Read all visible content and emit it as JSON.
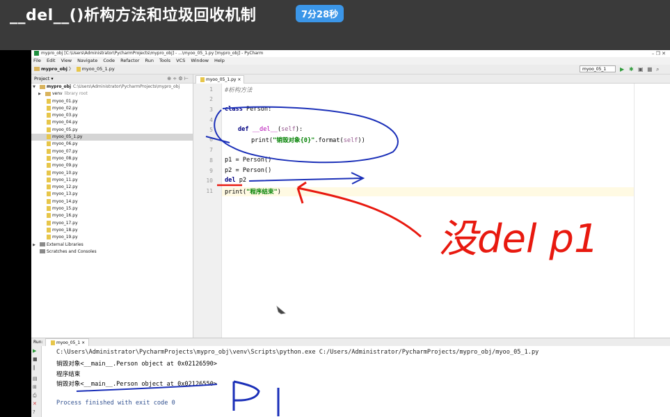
{
  "lesson": {
    "title": "__del__()析构方法和垃圾回收机制",
    "timer": "7分28秒"
  },
  "window": {
    "title": "mypro_obj [C:\\Users\\Administrator\\PycharmProjects\\mypro_obj] - ...\\myoo_05_1.py [mypro_obj] - PyCharm",
    "controls": "–  ❐  ✕"
  },
  "menu": [
    "File",
    "Edit",
    "View",
    "Navigate",
    "Code",
    "Refactor",
    "Run",
    "Tools",
    "VCS",
    "Window",
    "Help"
  ],
  "nav": {
    "project": "mypro_obj",
    "file": "myoo_05_1.py",
    "run_config": "myoo_05_1"
  },
  "project_panel": {
    "header": "Project",
    "root_name": "mypro_obj",
    "root_path": "C:\\Users\\Administrator\\PycharmProjects\\mypro_obj",
    "venv": "venv",
    "venv_note": "library root",
    "files": [
      "myoo_01.py",
      "myoo_02.py",
      "myoo_03.py",
      "myoo_04.py",
      "myoo_05.py",
      "myoo_05_1.py",
      "myoo_06.py",
      "myoo_07.py",
      "myoo_08.py",
      "myoo_09.py",
      "myoo_10.py",
      "myoo_11.py",
      "myoo_12.py",
      "myoo_13.py",
      "myoo_14.py",
      "myoo_15.py",
      "myoo_16.py",
      "myoo_17.py",
      "myoo_18.py",
      "myoo_19.py"
    ],
    "selected_file": "myoo_05_1.py",
    "external": "External Libraries",
    "scratches": "Scratches and Consoles"
  },
  "editor": {
    "tab": "myoo_05_1.py",
    "line_numbers": [
      "1",
      "2",
      "3",
      "4",
      "5",
      "6",
      "7",
      "8",
      "9",
      "10",
      "11"
    ],
    "lines": {
      "l1": "#析构方法",
      "l3_kw": "class",
      "l3_rest": " Person:",
      "l5_kw": "def",
      "l5_name": " __del__",
      "l5_open": "(",
      "l5_self": "self",
      "l5_close": "):",
      "l6_pre": "print(",
      "l6_str": "\"销毁对象{0}\"",
      "l6_mid": ".format(",
      "l6_self": "self",
      "l6_end": "))",
      "l8": "p1 = Person()",
      "l9": "p2 = Person()",
      "l10_kw": "del",
      "l10_rest": " p2",
      "l11_pre": "print(",
      "l11_str": "\"程序结束\"",
      "l11_end": ")"
    }
  },
  "run": {
    "label": "Run:",
    "tab": "myoo_05_1",
    "output": [
      "C:\\Users\\Administrator\\PycharmProjects\\mypro_obj\\venv\\Scripts\\python.exe C:/Users/Administrator/PycharmProjects/mypro_obj/myoo_05_1.py",
      "销毁对象<__main__.Person object at 0x02126590>",
      "程序结束",
      "销毁对象<__main__.Person object at 0x02126550>",
      "",
      "Process finished with exit code 0"
    ]
  },
  "annotations": {
    "handwritten_note": "没del p1",
    "color": "#e8190f",
    "blue": "#1a2fb8"
  }
}
